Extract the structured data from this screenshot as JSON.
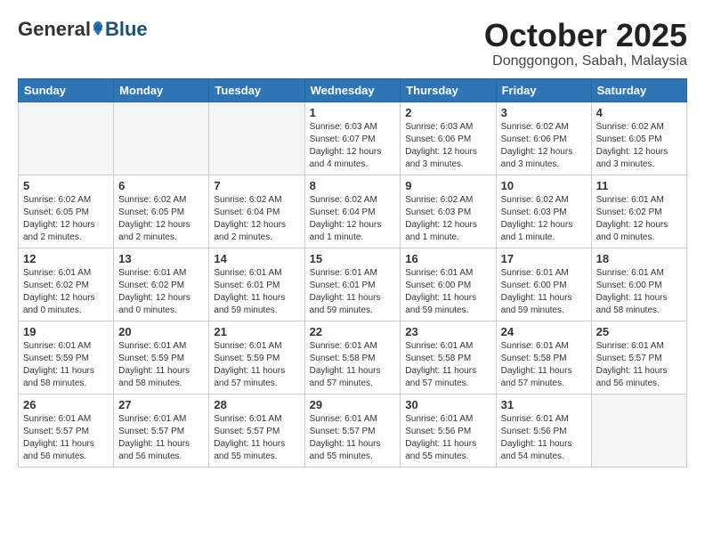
{
  "header": {
    "logo_general": "General",
    "logo_blue": "Blue",
    "month": "October 2025",
    "location": "Donggongon, Sabah, Malaysia"
  },
  "weekdays": [
    "Sunday",
    "Monday",
    "Tuesday",
    "Wednesday",
    "Thursday",
    "Friday",
    "Saturday"
  ],
  "weeks": [
    [
      {
        "day": "",
        "info": ""
      },
      {
        "day": "",
        "info": ""
      },
      {
        "day": "",
        "info": ""
      },
      {
        "day": "1",
        "info": "Sunrise: 6:03 AM\nSunset: 6:07 PM\nDaylight: 12 hours\nand 4 minutes."
      },
      {
        "day": "2",
        "info": "Sunrise: 6:03 AM\nSunset: 6:06 PM\nDaylight: 12 hours\nand 3 minutes."
      },
      {
        "day": "3",
        "info": "Sunrise: 6:02 AM\nSunset: 6:06 PM\nDaylight: 12 hours\nand 3 minutes."
      },
      {
        "day": "4",
        "info": "Sunrise: 6:02 AM\nSunset: 6:05 PM\nDaylight: 12 hours\nand 3 minutes."
      }
    ],
    [
      {
        "day": "5",
        "info": "Sunrise: 6:02 AM\nSunset: 6:05 PM\nDaylight: 12 hours\nand 2 minutes."
      },
      {
        "day": "6",
        "info": "Sunrise: 6:02 AM\nSunset: 6:05 PM\nDaylight: 12 hours\nand 2 minutes."
      },
      {
        "day": "7",
        "info": "Sunrise: 6:02 AM\nSunset: 6:04 PM\nDaylight: 12 hours\nand 2 minutes."
      },
      {
        "day": "8",
        "info": "Sunrise: 6:02 AM\nSunset: 6:04 PM\nDaylight: 12 hours\nand 1 minute."
      },
      {
        "day": "9",
        "info": "Sunrise: 6:02 AM\nSunset: 6:03 PM\nDaylight: 12 hours\nand 1 minute."
      },
      {
        "day": "10",
        "info": "Sunrise: 6:02 AM\nSunset: 6:03 PM\nDaylight: 12 hours\nand 1 minute."
      },
      {
        "day": "11",
        "info": "Sunrise: 6:01 AM\nSunset: 6:02 PM\nDaylight: 12 hours\nand 0 minutes."
      }
    ],
    [
      {
        "day": "12",
        "info": "Sunrise: 6:01 AM\nSunset: 6:02 PM\nDaylight: 12 hours\nand 0 minutes."
      },
      {
        "day": "13",
        "info": "Sunrise: 6:01 AM\nSunset: 6:02 PM\nDaylight: 12 hours\nand 0 minutes."
      },
      {
        "day": "14",
        "info": "Sunrise: 6:01 AM\nSunset: 6:01 PM\nDaylight: 11 hours\nand 59 minutes."
      },
      {
        "day": "15",
        "info": "Sunrise: 6:01 AM\nSunset: 6:01 PM\nDaylight: 11 hours\nand 59 minutes."
      },
      {
        "day": "16",
        "info": "Sunrise: 6:01 AM\nSunset: 6:00 PM\nDaylight: 11 hours\nand 59 minutes."
      },
      {
        "day": "17",
        "info": "Sunrise: 6:01 AM\nSunset: 6:00 PM\nDaylight: 11 hours\nand 59 minutes."
      },
      {
        "day": "18",
        "info": "Sunrise: 6:01 AM\nSunset: 6:00 PM\nDaylight: 11 hours\nand 58 minutes."
      }
    ],
    [
      {
        "day": "19",
        "info": "Sunrise: 6:01 AM\nSunset: 5:59 PM\nDaylight: 11 hours\nand 58 minutes."
      },
      {
        "day": "20",
        "info": "Sunrise: 6:01 AM\nSunset: 5:59 PM\nDaylight: 11 hours\nand 58 minutes."
      },
      {
        "day": "21",
        "info": "Sunrise: 6:01 AM\nSunset: 5:59 PM\nDaylight: 11 hours\nand 57 minutes."
      },
      {
        "day": "22",
        "info": "Sunrise: 6:01 AM\nSunset: 5:58 PM\nDaylight: 11 hours\nand 57 minutes."
      },
      {
        "day": "23",
        "info": "Sunrise: 6:01 AM\nSunset: 5:58 PM\nDaylight: 11 hours\nand 57 minutes."
      },
      {
        "day": "24",
        "info": "Sunrise: 6:01 AM\nSunset: 5:58 PM\nDaylight: 11 hours\nand 57 minutes."
      },
      {
        "day": "25",
        "info": "Sunrise: 6:01 AM\nSunset: 5:57 PM\nDaylight: 11 hours\nand 56 minutes."
      }
    ],
    [
      {
        "day": "26",
        "info": "Sunrise: 6:01 AM\nSunset: 5:57 PM\nDaylight: 11 hours\nand 56 minutes."
      },
      {
        "day": "27",
        "info": "Sunrise: 6:01 AM\nSunset: 5:57 PM\nDaylight: 11 hours\nand 56 minutes."
      },
      {
        "day": "28",
        "info": "Sunrise: 6:01 AM\nSunset: 5:57 PM\nDaylight: 11 hours\nand 55 minutes."
      },
      {
        "day": "29",
        "info": "Sunrise: 6:01 AM\nSunset: 5:57 PM\nDaylight: 11 hours\nand 55 minutes."
      },
      {
        "day": "30",
        "info": "Sunrise: 6:01 AM\nSunset: 5:56 PM\nDaylight: 11 hours\nand 55 minutes."
      },
      {
        "day": "31",
        "info": "Sunrise: 6:01 AM\nSunset: 5:56 PM\nDaylight: 11 hours\nand 54 minutes."
      },
      {
        "day": "",
        "info": ""
      }
    ]
  ]
}
